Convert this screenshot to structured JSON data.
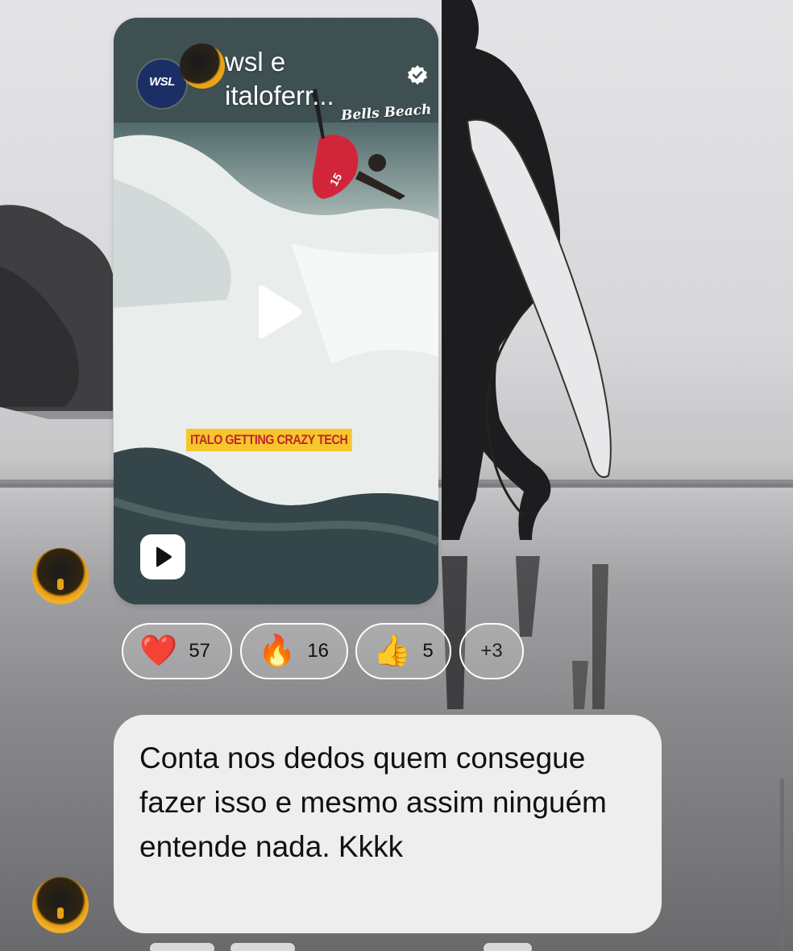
{
  "reel": {
    "author": "wsl e italoferr...",
    "account_avatar_label": "WSL",
    "event_logo_text": "Bells Beach",
    "caption_banner": "ITALO GETTING CRAZY TECH",
    "verified": true
  },
  "reactions": [
    {
      "emoji": "❤️",
      "icon": "heart-icon",
      "count": "57"
    },
    {
      "emoji": "🔥",
      "icon": "fire-icon",
      "count": "16"
    },
    {
      "emoji": "👍",
      "icon": "thumbs-up-icon",
      "count": "5"
    }
  ],
  "reactions_more": "+3",
  "message": {
    "text": "Conta nos dedos quem consegue fazer isso e mesmo assim ninguém entende nada. Kkkk"
  },
  "colors": {
    "bubble": "#eeeeee",
    "banner_bg": "#f5c72c",
    "banner_text": "#c3252b",
    "wsl_blue": "#1b2f66",
    "story_ring": "#f0b020"
  }
}
